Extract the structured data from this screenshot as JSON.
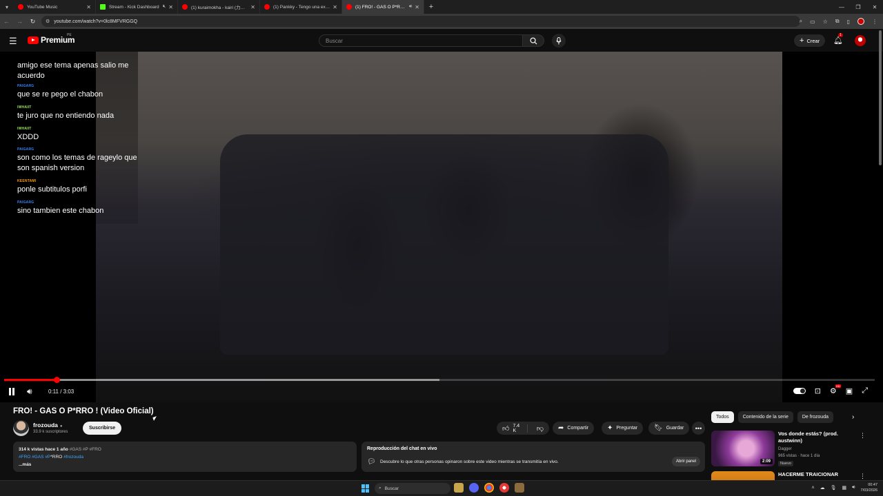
{
  "browser": {
    "tabs": [
      {
        "title": "YouTube Music",
        "favicon_color": "#ff0000",
        "active": false,
        "muted": false
      },
      {
        "title": "Stream - Kick Dashboard",
        "favicon_color": "#53fc18",
        "active": false,
        "muted": true
      },
      {
        "title": "(1) kuraimokha - kairi (力イリ) (...",
        "favicon_color": "#ff0000",
        "active": false,
        "muted": false
      },
      {
        "title": "(1) Pankky - Tengo una ex nue...",
        "favicon_color": "#ff0000",
        "active": false,
        "muted": false
      },
      {
        "title": "(1) FRO! - GAS O P*RRO ! (...",
        "favicon_color": "#ff0000",
        "active": true,
        "muted": true
      }
    ],
    "url": "youtube.com/watch?v=0lc8MFVRGGQ"
  },
  "masthead": {
    "logo_text": "Premium",
    "country_code": "PE",
    "search_placeholder": "Buscar",
    "create_label": "Crear",
    "notification_count": "1"
  },
  "chat_overlay": [
    {
      "user": "",
      "user_color": "#ffffff",
      "text": "amigo ese tema apenas salio me acuerdo"
    },
    {
      "user": "PAIGARG",
      "user_color": "#3b82f6",
      "text": "que se re pego el chabon"
    },
    {
      "user": "IWHAIIT",
      "user_color": "#9be15d",
      "text": "te juro que no entiendo nada"
    },
    {
      "user": "IWHAIIT",
      "user_color": "#9be15d",
      "text": "XDDD"
    },
    {
      "user": "PAIGARG",
      "user_color": "#3b82f6",
      "text": "son como los temas de rageylo que son spanish version"
    },
    {
      "user": "KEENTAMI",
      "user_color": "#f59e0b",
      "text": "ponle subtitulos porfi"
    },
    {
      "user": "PAIGARG",
      "user_color": "#3b82f6",
      "text": "sino tambien este chabon"
    }
  ],
  "player": {
    "current_time": "0:11",
    "duration": "3:03",
    "time_display": "0:11 / 3:03",
    "played_fraction": 0.06,
    "buffered_fraction": 0.5
  },
  "video": {
    "title": "FRO! - GAS O P*RRO ! (Video Oficial)",
    "channel": "frozouda",
    "subscribers": "33.9 k suscriptores",
    "subscribe_label": "Suscribirse",
    "likes": "7.4 K",
    "share_label": "Compartir",
    "ask_label": "Preguntar",
    "save_label": "Guardar"
  },
  "description": {
    "views_date": "314 k vistas  hace 1 año",
    "header_tags": "#GAS #P #FRO",
    "tags_line": [
      "#FRO",
      "#GAS",
      "#P",
      "*RRO",
      "#frozouda"
    ],
    "more_label": "...más"
  },
  "chat_replay": {
    "heading": "Reproducción del chat en vivo",
    "description": "Descubre lo que otras personas opinaron sobre este video mientras se transmitía en vivo.",
    "open_label": "Abrir panel"
  },
  "recommendations": {
    "chips": [
      "Todos",
      "Contenido de la serie",
      "De frozouda"
    ],
    "active_chip": "Todos",
    "items": [
      {
        "title": "Vos donde estás? (prod. austwinn)",
        "channel": "Dagger",
        "meta": "965 vistas · hace 1 día",
        "badge": "Nuevo",
        "duration": "2:09"
      },
      {
        "title": "HACERME TRAICIONAR",
        "channel": "",
        "meta": "",
        "badge": "",
        "duration": ""
      }
    ]
  },
  "taskbar": {
    "search_placeholder": "Buscar",
    "time": "00:47",
    "date": "7/03/2026"
  }
}
